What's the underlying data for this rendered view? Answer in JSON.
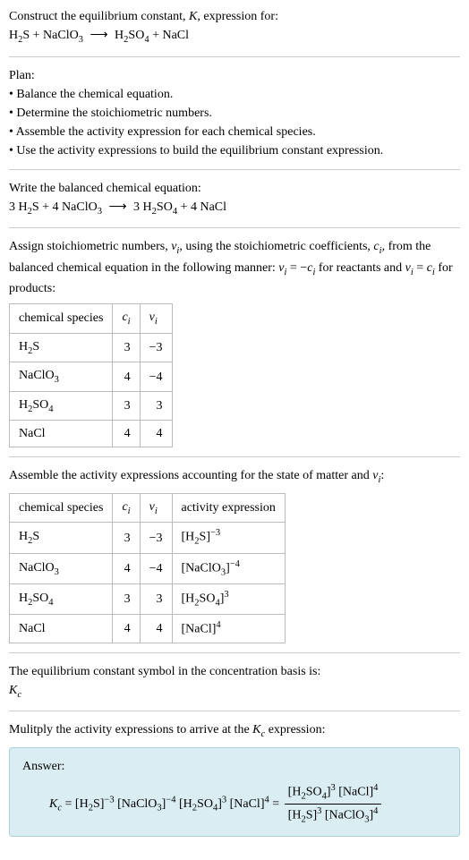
{
  "intro": {
    "line1": "Construct the equilibrium constant, ",
    "K": "K",
    "line1b": ", expression for:",
    "eq_lhs_1": "H",
    "eq_lhs_1s": "2",
    "eq_lhs_2": "S + NaClO",
    "eq_lhs_2s": "3",
    "arrow": "⟶",
    "eq_rhs_1": "H",
    "eq_rhs_1s": "2",
    "eq_rhs_2": "SO",
    "eq_rhs_2s": "4",
    "eq_rhs_3": " + NaCl"
  },
  "plan": {
    "heading": "Plan:",
    "b1": "• Balance the chemical equation.",
    "b2": "• Determine the stoichiometric numbers.",
    "b3": "• Assemble the activity expression for each chemical species.",
    "b4": "• Use the activity expressions to build the equilibrium constant expression."
  },
  "balanced": {
    "heading": "Write the balanced chemical equation:",
    "c1": "3 H",
    "c1s": "2",
    "c2": "S + 4 NaClO",
    "c2s": "3",
    "arrow": "⟶",
    "c3": "3 H",
    "c3s": "2",
    "c4": "SO",
    "c4s": "4",
    "c5": " + 4 NaCl"
  },
  "stoich": {
    "p1a": "Assign stoichiometric numbers, ",
    "nu": "ν",
    "i": "i",
    "p1b": ", using the stoichiometric coefficients, ",
    "c": "c",
    "p1c": ", from the balanced chemical equation in the following manner: ",
    "eq1a": " = −",
    "p1d": " for reactants and ",
    "eq2a": " = ",
    "p1e": " for products:",
    "col1": "chemical species",
    "col2c": "c",
    "col2i": "i",
    "col3n": "ν",
    "col3i": "i",
    "r1s": "H",
    "r1sub": "2",
    "r1s2": "S",
    "r1c": "3",
    "r1v": "−3",
    "r2s": "NaClO",
    "r2sub": "3",
    "r2c": "4",
    "r2v": "−4",
    "r3s": "H",
    "r3sub": "2",
    "r3s2": "SO",
    "r3sub2": "4",
    "r3c": "3",
    "r3v": "3",
    "r4s": "NaCl",
    "r4c": "4",
    "r4v": "4"
  },
  "activity": {
    "heading_a": "Assemble the activity expressions accounting for the state of matter and ",
    "nu": "ν",
    "i": "i",
    "heading_b": ":",
    "col4": "activity expression",
    "a1a": "[H",
    "a1sub": "2",
    "a1b": "S]",
    "a1exp": "−3",
    "a2a": "[NaClO",
    "a2sub": "3",
    "a2b": "]",
    "a2exp": "−4",
    "a3a": "[H",
    "a3sub": "2",
    "a3b": "SO",
    "a3sub2": "4",
    "a3c": "]",
    "a3exp": "3",
    "a4a": "[NaCl]",
    "a4exp": "4"
  },
  "ksym": {
    "line1": "The equilibrium constant symbol in the concentration basis is:",
    "K": "K",
    "c": "c"
  },
  "final": {
    "heading_a": "Mulitply the activity expressions to arrive at the ",
    "K": "K",
    "c": "c",
    "heading_b": " expression:",
    "answer": "Answer:",
    "eq_lhs_K": "K",
    "eq_lhs_c": "c",
    "eq": " = ",
    "t1a": "[H",
    "t1sub": "2",
    "t1b": "S]",
    "t1exp": "−3",
    "t2a": " [NaClO",
    "t2sub": "3",
    "t2b": "]",
    "t2exp": "−4",
    "t3a": " [H",
    "t3sub": "2",
    "t3b": "SO",
    "t3sub2": "4",
    "t3c": "]",
    "t3exp": "3",
    "t4a": " [NaCl]",
    "t4exp": "4",
    "eq2": " = ",
    "num_a": "[H",
    "num_sub": "2",
    "num_b": "SO",
    "num_sub2": "4",
    "num_c": "]",
    "num_exp": "3",
    "num_d": " [NaCl]",
    "num_exp2": "4",
    "den_a": "[H",
    "den_sub": "2",
    "den_b": "S]",
    "den_exp": "3",
    "den_c": " [NaClO",
    "den_sub2": "3",
    "den_d": "]",
    "den_exp2": "4"
  }
}
